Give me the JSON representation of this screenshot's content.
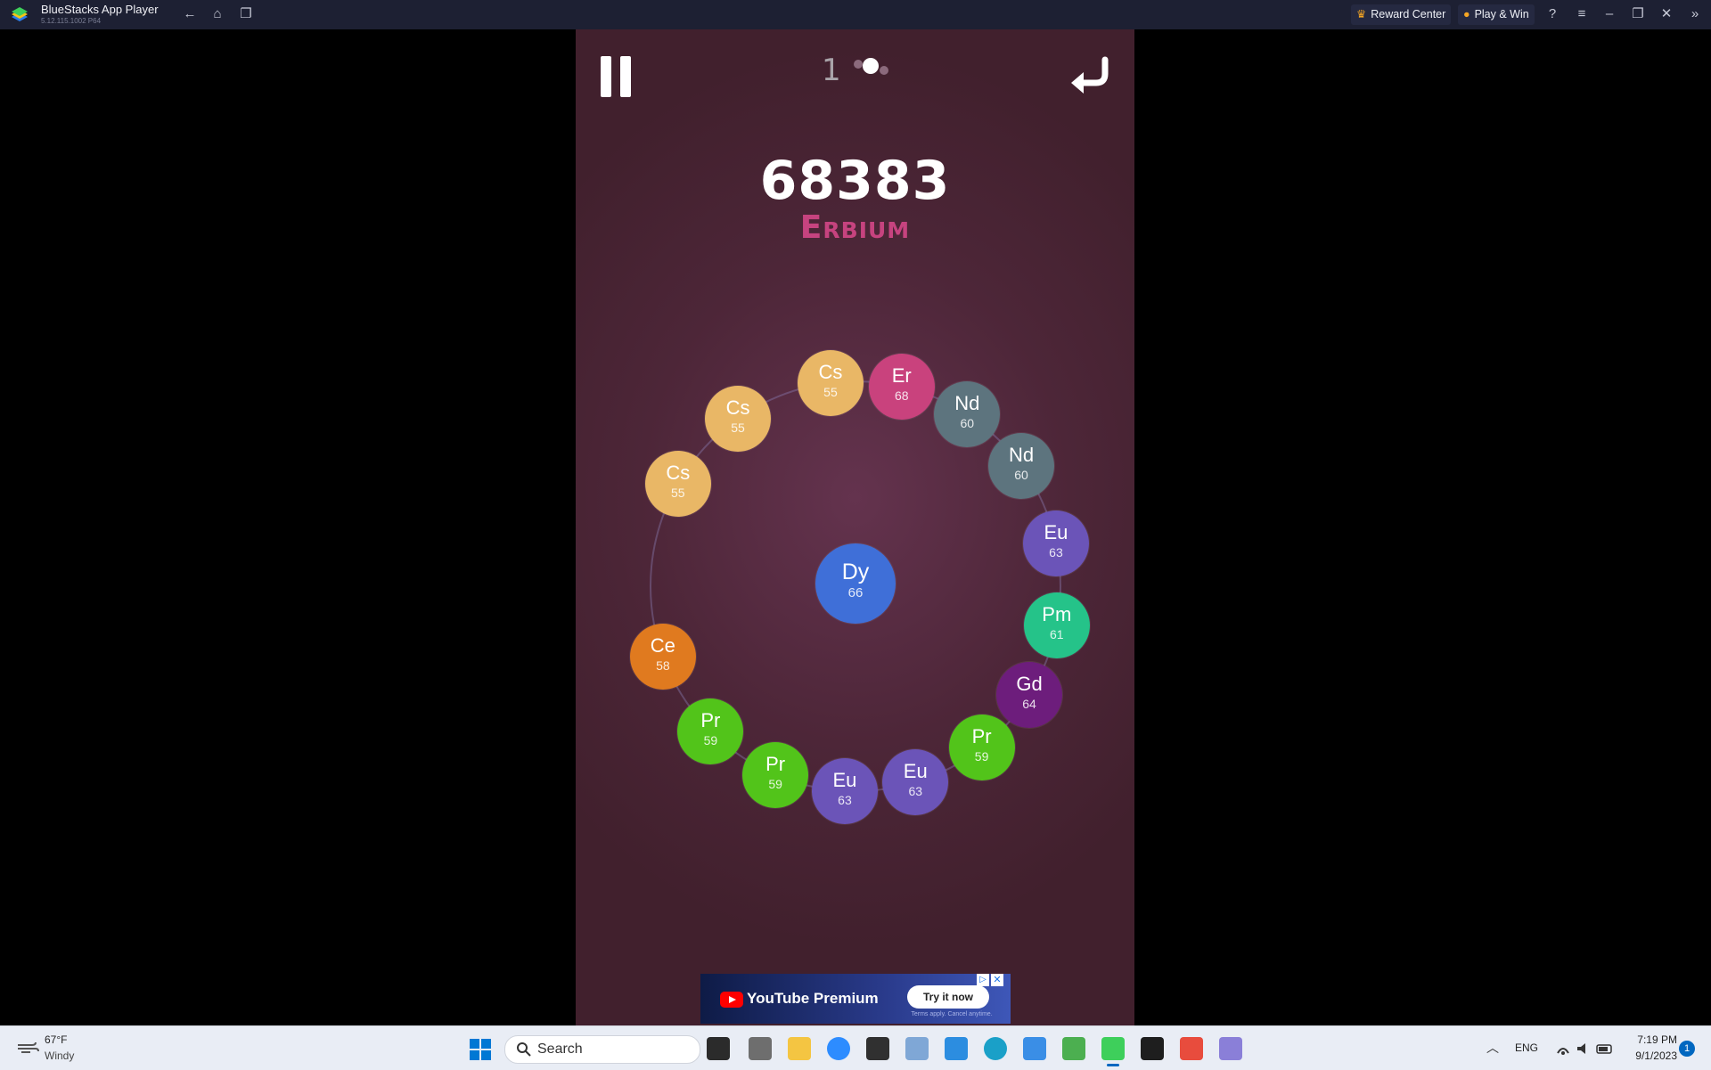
{
  "window": {
    "app_name": "BlueStacks App Player",
    "version": "5.12.115.1002 P64",
    "reward_center": "Reward Center",
    "play_win": "Play & Win"
  },
  "game": {
    "moves": "1",
    "score": "68383",
    "element_name": "Erbium",
    "center_atom": {
      "symbol": "Dy",
      "number": "66",
      "color": "#3f6fd8"
    },
    "ring_atoms": [
      {
        "symbol": "Cs",
        "number": "55",
        "color": "#e9b766"
      },
      {
        "symbol": "Er",
        "number": "68",
        "color": "#c9427d"
      },
      {
        "symbol": "Nd",
        "number": "60",
        "color": "#5d747e"
      },
      {
        "symbol": "Nd",
        "number": "60",
        "color": "#5d747e"
      },
      {
        "symbol": "Eu",
        "number": "63",
        "color": "#6b54b8"
      },
      {
        "symbol": "Pm",
        "number": "61",
        "color": "#25c389"
      },
      {
        "symbol": "Gd",
        "number": "64",
        "color": "#6d1d7c"
      },
      {
        "symbol": "Pr",
        "number": "59",
        "color": "#52c41a"
      },
      {
        "symbol": "Eu",
        "number": "63",
        "color": "#6b54b8"
      },
      {
        "symbol": "Eu",
        "number": "63",
        "color": "#6b54b8"
      },
      {
        "symbol": "Pr",
        "number": "59",
        "color": "#52c41a"
      },
      {
        "symbol": "Pr",
        "number": "59",
        "color": "#52c41a"
      },
      {
        "symbol": "Ce",
        "number": "58",
        "color": "#e07a1f"
      },
      {
        "symbol": "Cs",
        "number": "55",
        "color": "#e9b766"
      },
      {
        "symbol": "Cs",
        "number": "55",
        "color": "#e9b766"
      }
    ]
  },
  "ad": {
    "brand": "YouTube Premium",
    "cta": "Try it now",
    "terms": "Terms apply. Cancel anytime."
  },
  "taskbar": {
    "temperature": "67°F",
    "condition": "Windy",
    "search_placeholder": "Search",
    "language": "ENG",
    "time": "7:19 PM",
    "date": "9/1/2023",
    "notifications": "1"
  }
}
